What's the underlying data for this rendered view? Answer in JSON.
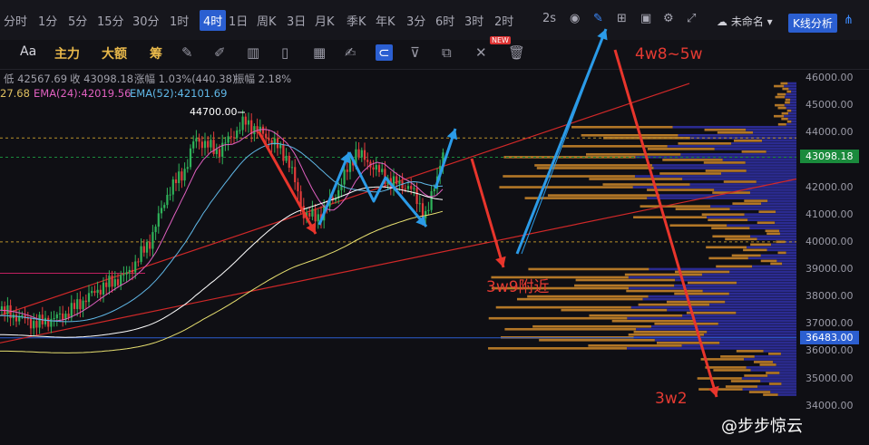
{
  "timeframes": [
    "分时",
    "1分",
    "5分",
    "15分",
    "30分",
    "1时",
    "4时",
    "1日",
    "周K",
    "3日",
    "月K",
    "季K",
    "年K",
    "3分",
    "6时",
    "3时",
    "2时"
  ],
  "active_timeframe": "4时",
  "interval_label": "2s",
  "workspace_name": "未命名",
  "kline_button": "K线分析",
  "toolbar": {
    "aa": "Aa",
    "main": "主力",
    "big": "大额",
    "chip": "筹",
    "new_badge": "NEW"
  },
  "ohlc": {
    "low": "低 42567.69",
    "close": "收 43098.18",
    "change": "涨幅 1.03%(440.38)",
    "amp": "振幅 2.18%"
  },
  "ema": {
    "ema_short": "27.68",
    "ema24": "EMA(24):42019.56",
    "ema52": "EMA(52):42101.69"
  },
  "price_axis": {
    "ticks": [
      "46000.00",
      "45000.00",
      "44000.00",
      "43000.00",
      "42000.00",
      "41000.00",
      "40000.00",
      "39000.00",
      "38000.00",
      "37000.00",
      "36000.00",
      "35000.00",
      "34000.00"
    ],
    "current_price": "43098.18",
    "support_price": "36483.00",
    "current_color": "#1a8a3c",
    "support_color": "#2c5fd0"
  },
  "high_label": "44700.00",
  "annotations": {
    "target_high": "4w8~5w",
    "pullback": "3w9附近",
    "target_low": "3w2"
  },
  "watermark": "@步步惊云",
  "chart_data": {
    "type": "candlestick",
    "interval": "4h",
    "ylim": [
      34000,
      46000
    ],
    "grid": false,
    "levels": {
      "current": 43098.18,
      "support": 36483.0,
      "dashed_high": 43800,
      "dashed_low": 40000,
      "marked_high": 44700.0
    },
    "channel": {
      "upper": [
        [
          0,
          37300
        ],
        [
          760,
          45800
        ]
      ],
      "lower": [
        [
          0,
          36300
        ],
        [
          878,
          42300
        ]
      ]
    },
    "projections": {
      "up_target": [
        48000,
        50000
      ],
      "pullback_target": 39000,
      "down_target": 32000
    },
    "volume_profile_colors": {
      "upper": "#d08a2a",
      "lower": "#2f2fa0"
    }
  }
}
